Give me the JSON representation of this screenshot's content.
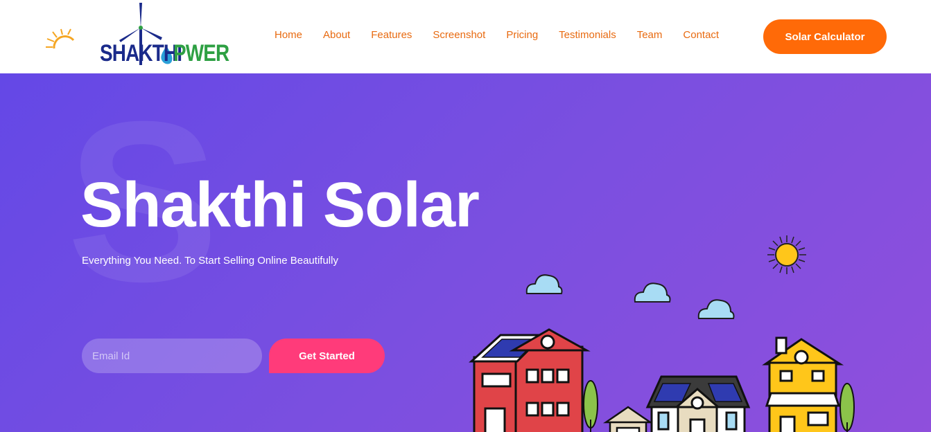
{
  "brand": {
    "logo_word_1": "SHAKTHI",
    "logo_word_2": "PWER"
  },
  "nav": {
    "items": [
      {
        "label": "Home"
      },
      {
        "label": "About"
      },
      {
        "label": "Features"
      },
      {
        "label": "Screenshot"
      },
      {
        "label": "Pricing"
      },
      {
        "label": "Testimonials"
      },
      {
        "label": "Team"
      },
      {
        "label": "Contact"
      }
    ],
    "cta_label": "Solar Calculator"
  },
  "hero": {
    "watermark_letter": "S",
    "title": "Shakthi Solar",
    "subtitle": "Everything You Need. To Start Selling Online Beautifully",
    "email_placeholder": "Email Id",
    "button_label": "Get Started"
  },
  "colors": {
    "nav_text": "#e86a10",
    "cta_bg": "#ff6a08",
    "hero_gradient_start": "#6448e6",
    "hero_gradient_end": "#8f4fdc",
    "start_button": "#ff3b7a",
    "logo_blue": "#1a2a8a",
    "logo_green": "#2ea043"
  }
}
